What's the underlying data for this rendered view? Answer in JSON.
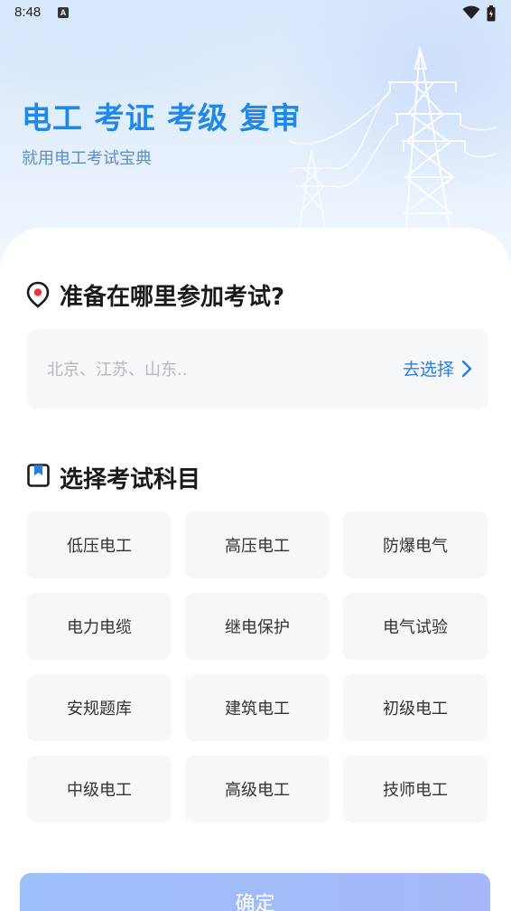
{
  "status_bar": {
    "time": "8:48",
    "notification_icon": "a-icon",
    "wifi_icon": "wifi-icon",
    "battery_icon": "battery-icon"
  },
  "hero": {
    "title": "电工 考证 考级 复审",
    "subtitle": "就用电工考试宝典",
    "title_color": "#1f88e8"
  },
  "location": {
    "heading": "准备在哪里参加考试?",
    "icon": "location-pin-icon",
    "placeholder": "北京、江苏、山东..",
    "select_label": "去选择",
    "select_icon": "chevron-right-icon",
    "accent_color": "#e8393f"
  },
  "subjects": {
    "heading": "选择考试科目",
    "icon": "bookmark-icon",
    "items": [
      {
        "label": "低压电工"
      },
      {
        "label": "高压电工"
      },
      {
        "label": "防爆电气"
      },
      {
        "label": "电力电缆"
      },
      {
        "label": "继电保护"
      },
      {
        "label": "电气试验"
      },
      {
        "label": "安规题库"
      },
      {
        "label": "建筑电工"
      },
      {
        "label": "初级电工"
      },
      {
        "label": "中级电工"
      },
      {
        "label": "高级电工"
      },
      {
        "label": "技师电工"
      }
    ]
  },
  "confirm": {
    "label": "确定"
  }
}
